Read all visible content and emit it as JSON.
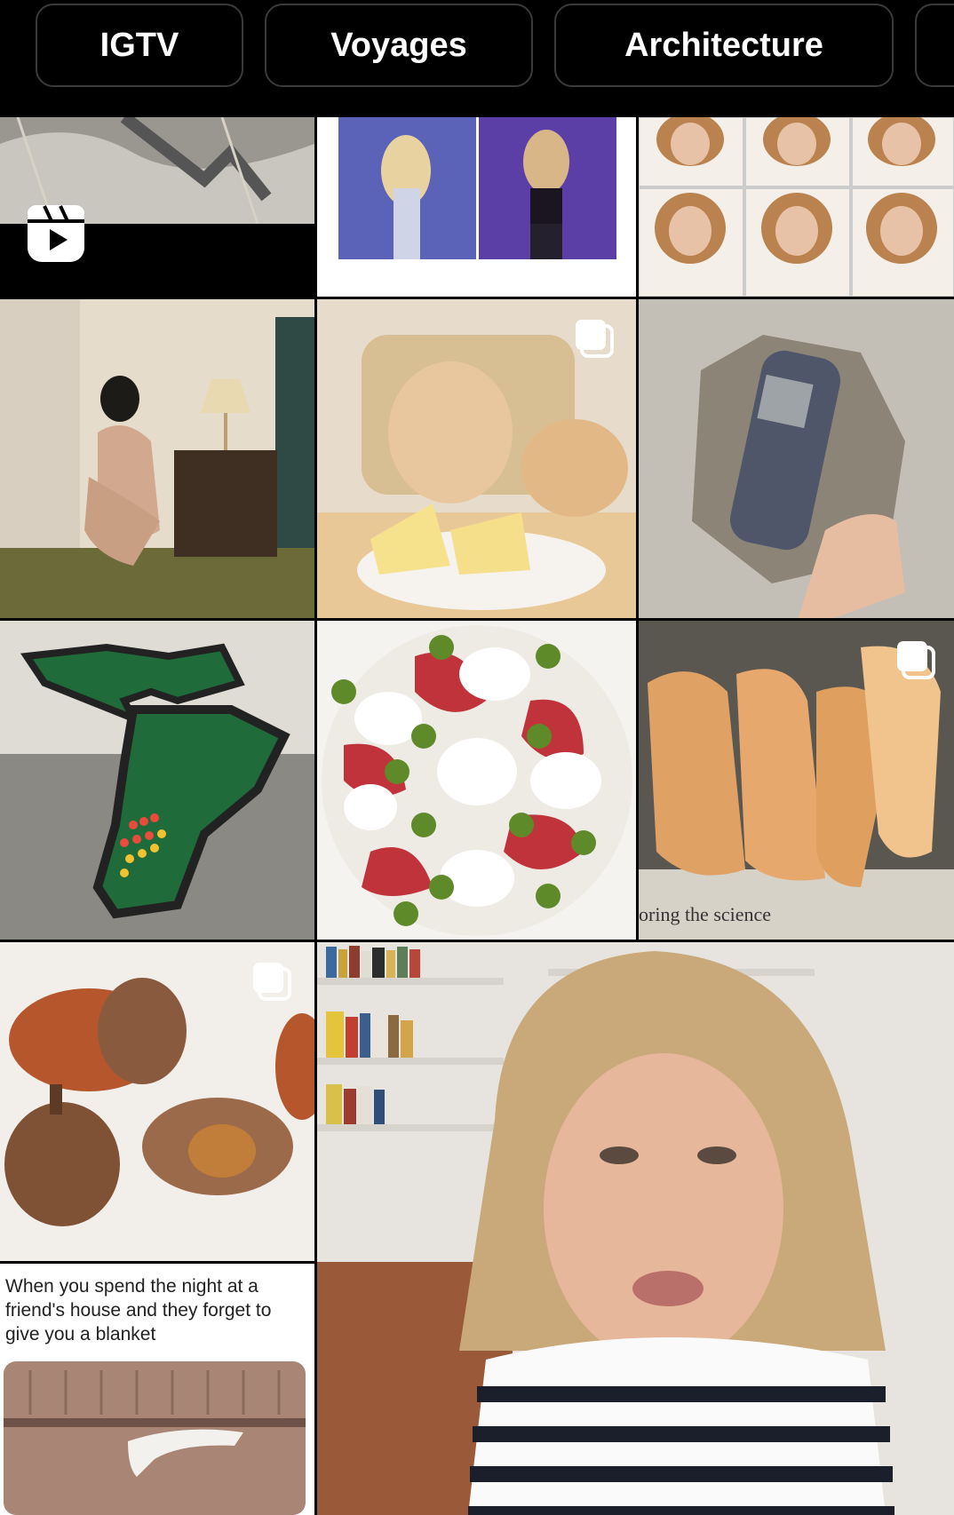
{
  "categories": [
    {
      "label": "IGTV"
    },
    {
      "label": "Voyages"
    },
    {
      "label": "Architecture"
    },
    {
      "label": ""
    }
  ],
  "grid": {
    "tiles": [
      {
        "name": "reel-cat-video",
        "badge": "reel-icon"
      },
      {
        "name": "concert-photos",
        "badge": ""
      },
      {
        "name": "portrait-collage",
        "badge": ""
      },
      {
        "name": "vintage-bedroom-photo",
        "badge": ""
      },
      {
        "name": "cats-with-cheese",
        "badge": "multiple-posts-icon"
      },
      {
        "name": "fossil-phone-rock",
        "badge": ""
      },
      {
        "name": "map-pool-table",
        "badge": ""
      },
      {
        "name": "burrata-salad",
        "badge": ""
      },
      {
        "name": "fried-chips",
        "badge": "multiple-posts-icon"
      },
      {
        "name": "acorn-desserts",
        "badge": "multiple-posts-icon"
      },
      {
        "name": "woman-talking-video",
        "badge": ""
      },
      {
        "name": "blanket-meme",
        "badge": ""
      }
    ],
    "meme_caption": "When you spend the night at a friend's house and they forget to give you a blanket",
    "chips_overlay_text": "oring the science"
  },
  "colors": {
    "background": "#000000",
    "chip_border": "#3a3a3a",
    "chip_text": "#ffffff"
  }
}
